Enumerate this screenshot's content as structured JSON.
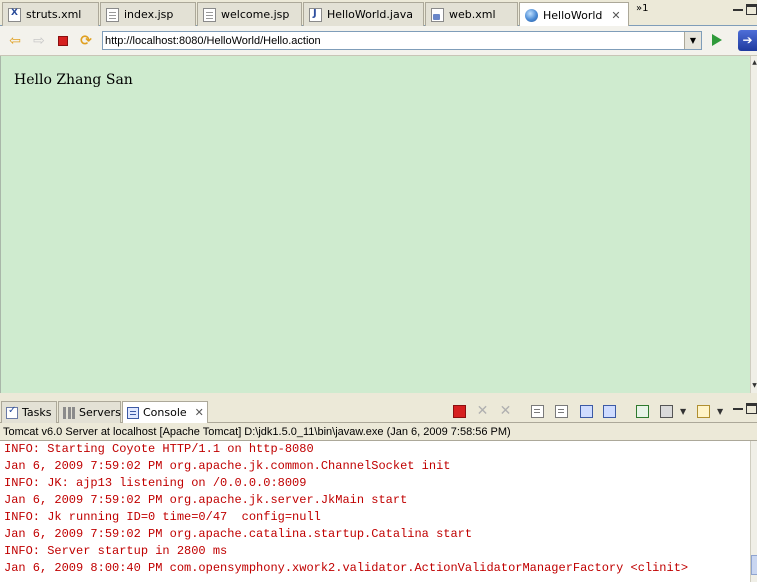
{
  "editor_tabs": [
    {
      "label": "struts.xml",
      "icon": "xml-file-icon"
    },
    {
      "label": "index.jsp",
      "icon": "jsp-file-icon"
    },
    {
      "label": "welcome.jsp",
      "icon": "jsp-file-icon"
    },
    {
      "label": "HelloWorld.java",
      "icon": "java-file-icon"
    },
    {
      "label": "web.xml",
      "icon": "web-xml-file-icon"
    },
    {
      "label": "HelloWorld",
      "icon": "globe-icon",
      "active": true,
      "close": "✕"
    }
  ],
  "overflow": {
    "label": "»1"
  },
  "browser": {
    "url": "http://localhost:8080/HelloWorld/Hello.action",
    "icons": [
      "back-arrow-icon",
      "forward-arrow-icon",
      "stop-icon",
      "refresh-icon",
      "go-icon"
    ]
  },
  "page": {
    "greeting": "Hello Zhang San",
    "background": "#cfebcf"
  },
  "views": {
    "tabs": [
      {
        "label": "Tasks",
        "icon": "tasks-icon"
      },
      {
        "label": "Servers",
        "icon": "servers-icon"
      },
      {
        "label": "Console",
        "icon": "console-icon",
        "active": true,
        "close": "✕"
      }
    ]
  },
  "console": {
    "header": "Tomcat v6.0 Server at localhost [Apache Tomcat] D:\\jdk1.5.0_11\\bin\\javaw.exe (Jan 6, 2009 7:58:56 PM)",
    "text_color": "#c00000",
    "lines": [
      "INFO: Starting Coyote HTTP/1.1 on http-8080",
      "Jan 6, 2009 7:59:02 PM org.apache.jk.common.ChannelSocket init",
      "INFO: JK: ajp13 listening on /0.0.0.0:8009",
      "Jan 6, 2009 7:59:02 PM org.apache.jk.server.JkMain start",
      "INFO: Jk running ID=0 time=0/47  config=null",
      "Jan 6, 2009 7:59:02 PM org.apache.catalina.startup.Catalina start",
      "INFO: Server startup in 2800 ms",
      "Jan 6, 2009 8:00:40 PM com.opensymphony.xwork2.validator.ActionValidatorManagerFactory <clinit>"
    ]
  }
}
